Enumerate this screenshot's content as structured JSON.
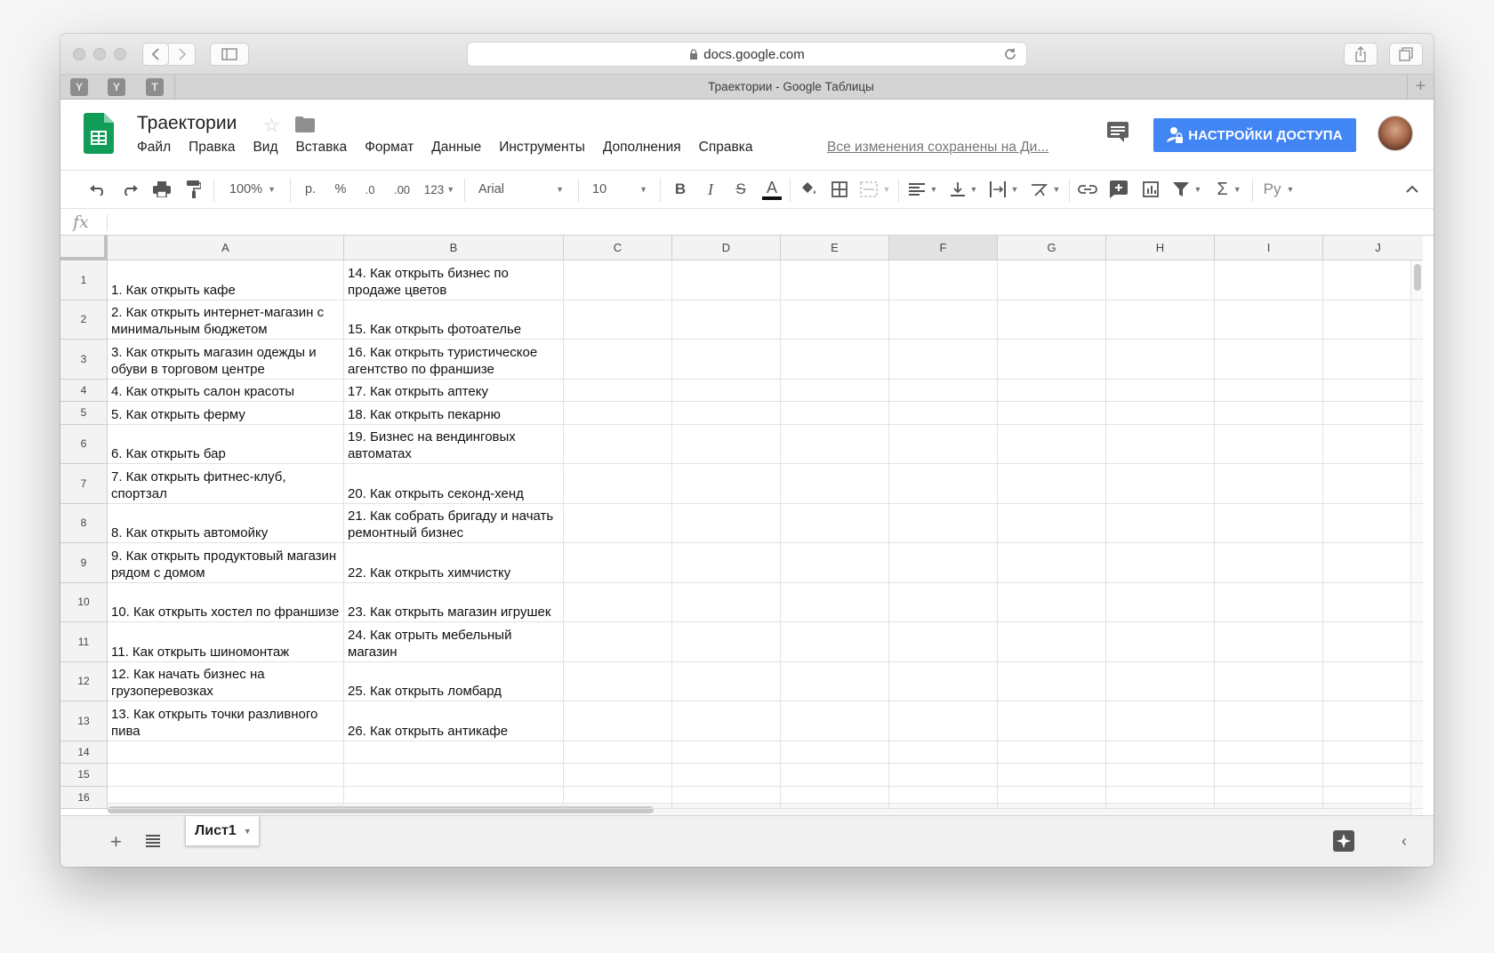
{
  "browser": {
    "url": "docs.google.com",
    "tab_title": "Траектории - Google Таблицы",
    "pinned_tabs": [
      "Y",
      "Y",
      "T"
    ]
  },
  "doc": {
    "title": "Траектории",
    "menu": [
      "Файл",
      "Правка",
      "Вид",
      "Вставка",
      "Формат",
      "Данные",
      "Инструменты",
      "Дополнения",
      "Справка"
    ],
    "saved_status": "Все изменения сохранены на Ди...",
    "share_label": "НАСТРОЙКИ ДОСТУПА",
    "accent": "#4285f4",
    "logo_color": "#0f9d58"
  },
  "toolbar": {
    "zoom": "100%",
    "currency": "р.",
    "percent": "%",
    "decimal_decrease": ".0",
    "decimal_increase": ".00",
    "format_more": "123",
    "font": "Arial",
    "font_size": "10",
    "input_tools": "Ру"
  },
  "formula_bar": {
    "fx_label": "fx",
    "value": ""
  },
  "grid": {
    "columns": [
      "A",
      "B",
      "C",
      "D",
      "E",
      "F",
      "G",
      "H",
      "I",
      "J"
    ],
    "selected_column": "F",
    "rows": [
      {
        "num": "1",
        "a": "1. Как открыть кафе",
        "b": "14. Как открыть бизнес по продаже цветов"
      },
      {
        "num": "2",
        "a": "2. Как открыть интернет-магазин с минимальным бюджетом",
        "b": "15. Как открыть фотоателье"
      },
      {
        "num": "3",
        "a": "3. Как открыть магазин одежды и обуви в торговом центре",
        "b": "16. Как открыть туристическое агентство по франшизе"
      },
      {
        "num": "4",
        "a": "4. Как открыть салон красоты",
        "b": "17. Как открыть аптеку"
      },
      {
        "num": "5",
        "a": "5. Как открыть ферму",
        "b": "18. Как открыть пекарню"
      },
      {
        "num": "6",
        "a": "6. Как открыть бар",
        "b": "19. Бизнес на вендинговых автоматах"
      },
      {
        "num": "7",
        "a": "7. Как открыть фитнес-клуб, спортзал",
        "b": "20. Как открыть секонд-хенд"
      },
      {
        "num": "8",
        "a": "8. Как открыть автомойку",
        "b": "21. Как собрать бригаду и начать ремонтный бизнес"
      },
      {
        "num": "9",
        "a": "9. Как открыть продуктовый магазин рядом с домом",
        "b": "22. Как открыть химчистку"
      },
      {
        "num": "10",
        "a": "10. Как открыть хостел по франшизе",
        "b": "23. Как открыть магазин игрушек"
      },
      {
        "num": "11",
        "a": "11. Как открыть шиномонтаж",
        "b": "24. Как отрыть мебельный магазин"
      },
      {
        "num": "12",
        "a": "12. Как начать бизнес на грузоперевозках",
        "b": "25. Как открыть ломбард"
      },
      {
        "num": "13",
        "a": "13. Как открыть точки разливного пива",
        "b": "26. Как открыть антикафе"
      },
      {
        "num": "14",
        "a": "",
        "b": ""
      },
      {
        "num": "15",
        "a": "",
        "b": ""
      },
      {
        "num": "16",
        "a": "",
        "b": ""
      }
    ]
  },
  "sheets": {
    "tabs": [
      "Лист1"
    ]
  }
}
